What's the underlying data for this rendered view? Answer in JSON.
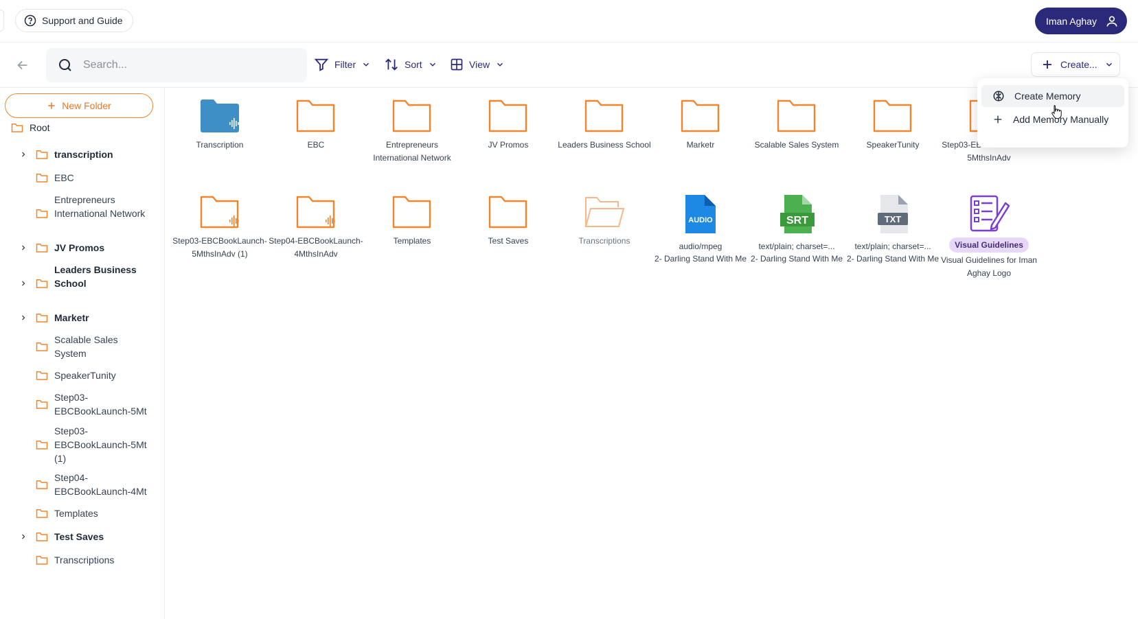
{
  "header": {
    "support_label": "Support and Guide",
    "user_name": "Iman Aghay"
  },
  "toolbar": {
    "search_placeholder": "Search...",
    "filter_label": "Filter",
    "sort_label": "Sort",
    "view_label": "View",
    "create_label": "Create..."
  },
  "create_menu": {
    "items": [
      {
        "label": "Create Memory",
        "icon": "brain-icon"
      },
      {
        "label": "Add Memory Manually",
        "icon": "plus-icon"
      }
    ]
  },
  "sidebar": {
    "new_folder_label": "New Folder",
    "root_label": "Root",
    "items": [
      {
        "label": "transcription",
        "expandable": true
      },
      {
        "label": "EBC",
        "expandable": false
      },
      {
        "label": "Entrepreneurs International Network",
        "expandable": false
      },
      {
        "label": "JV Promos",
        "expandable": true
      },
      {
        "label": "Leaders Business School",
        "expandable": true
      },
      {
        "label": "Marketr",
        "expandable": true
      },
      {
        "label": "Scalable Sales System",
        "expandable": false
      },
      {
        "label": "SpeakerTunity",
        "expandable": false
      },
      {
        "label": "Step03-EBCBookLaunch-5Mt",
        "expandable": false
      },
      {
        "label": "Step03-EBCBookLaunch-5Mt (1)",
        "expandable": false
      },
      {
        "label": "Step04-EBCBookLaunch-4Mt",
        "expandable": false
      },
      {
        "label": "Templates",
        "expandable": false
      },
      {
        "label": "Test Saves",
        "expandable": true
      },
      {
        "label": "Transcriptions",
        "expandable": false
      }
    ]
  },
  "grid": {
    "items": [
      {
        "type": "folder-audio-blue",
        "name": "Transcription"
      },
      {
        "type": "folder",
        "name": "EBC"
      },
      {
        "type": "folder",
        "name": "Entrepreneurs International Network"
      },
      {
        "type": "folder",
        "name": "JV Promos"
      },
      {
        "type": "folder",
        "name": "Leaders Business School"
      },
      {
        "type": "folder",
        "name": "Marketr"
      },
      {
        "type": "folder",
        "name": "Scalable Sales System"
      },
      {
        "type": "folder",
        "name": "SpeakerTunity"
      },
      {
        "type": "folder",
        "name": "Step03-EBCBookLaunch-5MthsInAdv"
      },
      {
        "type": "folder-audio",
        "name": "Step03-EBCBookLaunch-5MthsInAdv (1)"
      },
      {
        "type": "folder-audio",
        "name": "Step04-EBCBookLaunch-4MthsInAdv"
      },
      {
        "type": "folder",
        "name": "Templates"
      },
      {
        "type": "folder",
        "name": "Test Saves"
      },
      {
        "type": "folder-open",
        "name": "Transcriptions"
      },
      {
        "type": "file-audio",
        "sub": "audio/mpeg",
        "name": "2- Darling Stand With Me",
        "icon_text": "AUDIO"
      },
      {
        "type": "file-srt",
        "sub": "text/plain; charset=...",
        "name": "2- Darling Stand With Me",
        "icon_text": "SRT"
      },
      {
        "type": "file-txt",
        "sub": "text/plain; charset=...",
        "name": "2- Darling Stand With Me",
        "icon_text": "TXT"
      },
      {
        "type": "guidelines",
        "badge": "Visual Guidelines",
        "name": "Visual Guidelines for Iman Aghay Logo"
      }
    ]
  },
  "colors": {
    "brand": "#2b2a7a",
    "folder_orange": "#f0852d",
    "folder_blue": "#3d8fc6",
    "audio_blue": "#1e88e5",
    "srt_green": "#3a9a3a",
    "txt_gray": "#5f6b7a",
    "guideline_purple": "#7b3fd0"
  }
}
